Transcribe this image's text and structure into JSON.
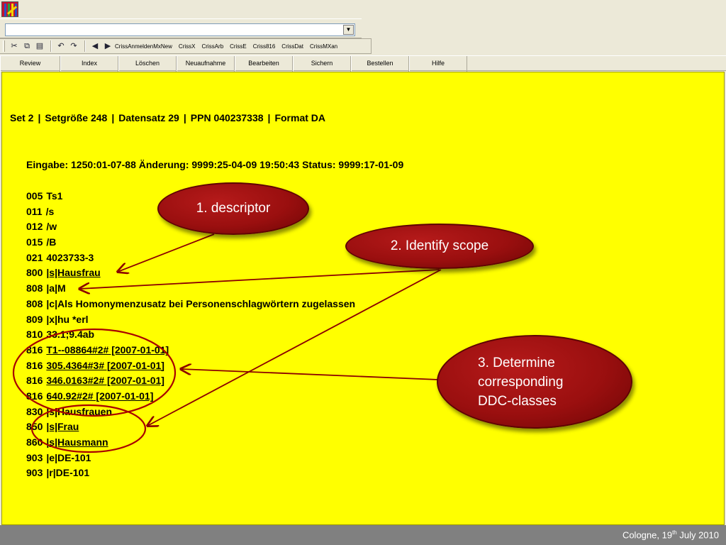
{
  "app": {
    "icon": "app-logo-icon"
  },
  "combo": {
    "value": ""
  },
  "toolbar": {
    "icons": [
      "cut-icon",
      "copy-icon",
      "paste-icon",
      "undo-icon",
      "redo-icon",
      "back-arrow-icon",
      "forward-arrow-icon"
    ],
    "commands": [
      "CrissAnmeldenMxNew",
      "CrissX",
      "CrissArb",
      "CrissE",
      "Criss816",
      "CrissDat",
      "CrissMXan"
    ]
  },
  "menu": [
    "Review",
    "Index",
    "Löschen",
    "Neuaufnahme",
    "Bearbeiten",
    "Sichern",
    "Bestellen",
    "Hilfe"
  ],
  "record": {
    "header": {
      "set": "Set 2",
      "size": "Setgröße 248",
      "record": "Datensatz 29",
      "ppn": "PPN 040237338",
      "format": "Format DA"
    },
    "meta": "Eingabe: 1250:01-07-88 Änderung: 9999:25-04-09 19:50:43 Status: 9999:17-01-09",
    "fields": [
      {
        "tag": "005",
        "value": "Ts1"
      },
      {
        "tag": "011",
        "value": "/s"
      },
      {
        "tag": "012",
        "value": "/w"
      },
      {
        "tag": "015",
        "value": "/B"
      },
      {
        "tag": "021",
        "value": "4023733-3"
      },
      {
        "tag": "800",
        "value": "|s|Hausfrau"
      },
      {
        "tag": "808",
        "value": "|a|M"
      },
      {
        "tag": "808",
        "value": "|c|Als Homonymenzusatz bei Personenschlagwörtern zugelassen"
      },
      {
        "tag": "809",
        "value": "|x|hu *erl"
      },
      {
        "tag": "810",
        "value": "33.1;9.4ab"
      },
      {
        "tag": "816",
        "value": "T1--08864#2# [2007-01-01]"
      },
      {
        "tag": "816",
        "value": "305.4364#3# [2007-01-01]"
      },
      {
        "tag": "816",
        "value": "346.0163#2# [2007-01-01]"
      },
      {
        "tag": "816",
        "value": "640.92#2# [2007-01-01]"
      },
      {
        "tag": "830",
        "value": "|s|Hausfrauen"
      },
      {
        "tag": "850",
        "value": "|s|Frau"
      },
      {
        "tag": "860",
        "value": "|s|Hausmann"
      },
      {
        "tag": "903",
        "value": "|e|DE-101"
      },
      {
        "tag": "903",
        "value": "|r|DE-101"
      }
    ]
  },
  "annotations": {
    "step1": "1. descriptor",
    "step2": "2. Identify scope",
    "step3": "3. Determine corresponding DDC-classes",
    "colors": {
      "bubble": "#9a0f0f",
      "lines": "#8b0000"
    }
  },
  "footer": {
    "prefix": "Cologne, 19",
    "sup": "th",
    "suffix": " July 2010"
  }
}
